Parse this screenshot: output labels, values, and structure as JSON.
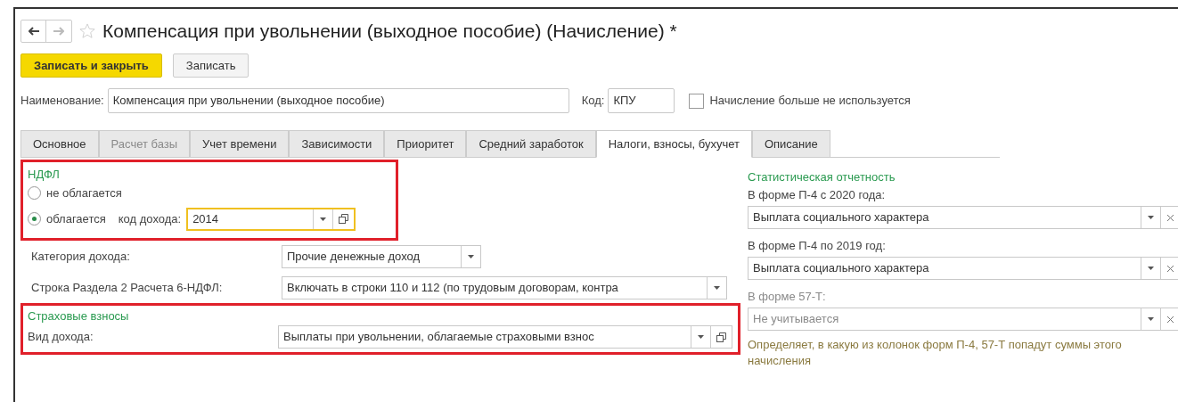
{
  "window": {
    "title": "Компенсация при увольнении (выходное пособие) (Начисление) *",
    "back_enabled": true,
    "forward_enabled": false,
    "favorite": false
  },
  "toolbar": [
    {
      "label": "Записать и закрыть",
      "kind": "primary"
    },
    {
      "label": "Записать",
      "kind": "default"
    }
  ],
  "name_field": {
    "label": "Наименование:",
    "value": "Компенсация при увольнении (выходное пособие)"
  },
  "code_field": {
    "label": "Код:",
    "value": "КПУ"
  },
  "not_used": {
    "label": "Начисление больше не используется",
    "checked": false
  },
  "tabs": [
    {
      "label": "Основное",
      "selected": false,
      "disabled": false
    },
    {
      "label": "Расчет базы",
      "selected": false,
      "disabled": true
    },
    {
      "label": "Учет времени",
      "selected": false,
      "disabled": false
    },
    {
      "label": "Зависимости",
      "selected": false,
      "disabled": false
    },
    {
      "label": "Приоритет",
      "selected": false,
      "disabled": false
    },
    {
      "label": "Средний заработок",
      "selected": false,
      "disabled": false
    },
    {
      "label": "Налоги, взносы, бухучет",
      "selected": true,
      "disabled": false
    },
    {
      "label": "Описание",
      "selected": false,
      "disabled": false
    }
  ],
  "ndfl": {
    "title": "НДФЛ",
    "highlighted": true,
    "options": [
      {
        "label": "не облагается",
        "selected": false
      },
      {
        "label": "облагается",
        "selected": true
      }
    ],
    "income_code": {
      "label": "код дохода:",
      "value": "2014",
      "focused": true
    }
  },
  "income_category": {
    "label": "Категория дохода:",
    "value": "Прочие денежные доход"
  },
  "line_6ndfl": {
    "label": "Строка Раздела 2 Расчета 6-НДФЛ:",
    "value": "Включать в строки 110 и 112 (по трудовым договорам, контра"
  },
  "insurance": {
    "title": "Страховые взносы",
    "highlighted": true,
    "income_type": {
      "label": "Вид дохода:",
      "value": "Выплаты при увольнении, облагаемые страховыми взнос"
    }
  },
  "statistics": {
    "title": "Статистическая отчетность",
    "fields": [
      {
        "label": "В форме П-4 с 2020 года:",
        "value": "Выплата социального характера",
        "disabled": false
      },
      {
        "label": "В форме П-4 по 2019 год:",
        "value": "Выплата социального характера",
        "disabled": false
      },
      {
        "label": "В форме 57-Т:",
        "value": "Не учитывается",
        "disabled": true
      }
    ],
    "note": "Определяет, в какую из колонок форм П-4, 57-Т попадут суммы этого начисления"
  }
}
